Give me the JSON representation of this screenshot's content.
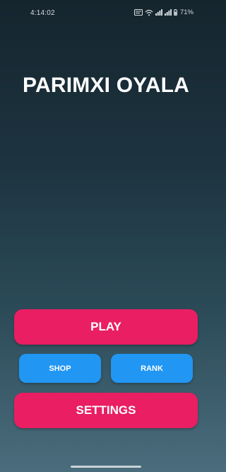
{
  "status_bar": {
    "time": "4:14:02",
    "battery": "71%",
    "icons": [
      "volte-icon",
      "wifi-icon",
      "signal-icon",
      "signal-icon",
      "battery-icon"
    ]
  },
  "title": "PARIMXI OYALA",
  "buttons": {
    "play": "PLAY",
    "shop": "SHOP",
    "rank": "RANK",
    "settings": "SETTINGS"
  },
  "colors": {
    "primary_button": "#e91e63",
    "secondary_button": "#2196f3",
    "background_top": "#15252e",
    "background_bottom": "#4a6d7d"
  }
}
